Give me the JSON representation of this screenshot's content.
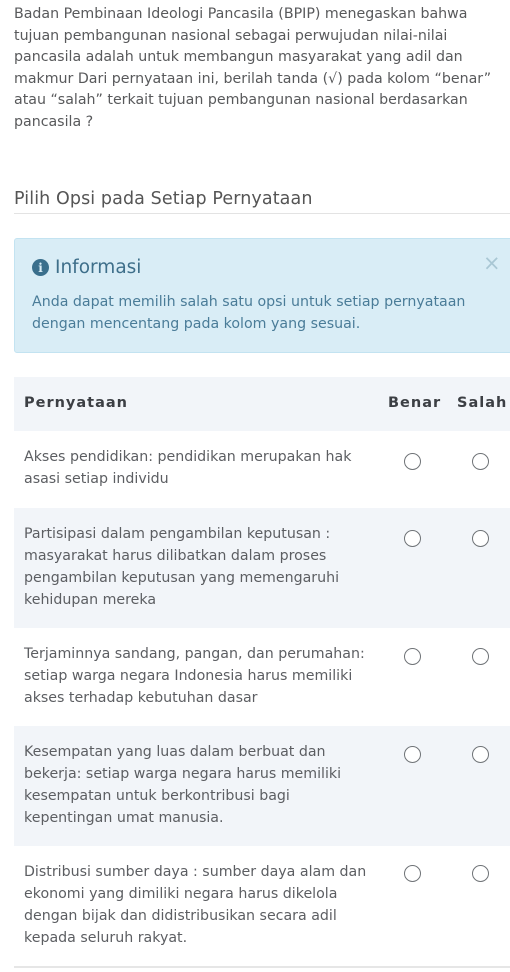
{
  "question": {
    "text": "Badan Pembinaan Ideologi Pancasila (BPIP) menegaskan bahwa tujuan pembangunan nasional sebagai perwujudan nilai-nilai pancasila adalah untuk membangun masyarakat yang adil dan makmur Dari pernyataan ini, berilah tanda (√) pada kolom “benar” atau “salah” terkait tujuan pembangunan nasional berdasarkan pancasila ?"
  },
  "section": {
    "title": "Pilih Opsi pada Setiap Pernyataan"
  },
  "alert": {
    "icon": "info-circle-icon",
    "title": "Informasi",
    "close": "×",
    "body": "Anda dapat memilih salah satu opsi untuk setiap pernyataan dengan mencentang pada kolom yang sesuai."
  },
  "table": {
    "headers": {
      "statement": "Pernyataan",
      "true": "Benar",
      "false": "Salah"
    },
    "rows": [
      {
        "statement": "Akses pendidikan: pendidikan merupakan hak asasi setiap individu"
      },
      {
        "statement": "Partisipasi dalam pengambilan keputusan : masyarakat harus dilibatkan dalam proses pengambilan keputusan yang memengaruhi kehidupan mereka"
      },
      {
        "statement": "Terjaminnya sandang, pangan, dan perumahan: setiap warga negara Indonesia harus memiliki akses terhadap kebutuhan dasar"
      },
      {
        "statement": "Kesempatan yang luas dalam berbuat dan bekerja: setiap warga negara harus memiliki kesempatan untuk berkontribusi bagi kepentingan umat manusia."
      },
      {
        "statement": "Distribusi sumber daya : sumber daya alam dan ekonomi yang dimiliki negara harus dikelola dengan bijak dan didistribusikan secara adil kepada seluruh rakyat."
      }
    ]
  },
  "colors": {
    "alert_bg": "#d9edf6",
    "alert_text": "#3e6f8a",
    "row_alt_bg": "#f2f5f9"
  }
}
